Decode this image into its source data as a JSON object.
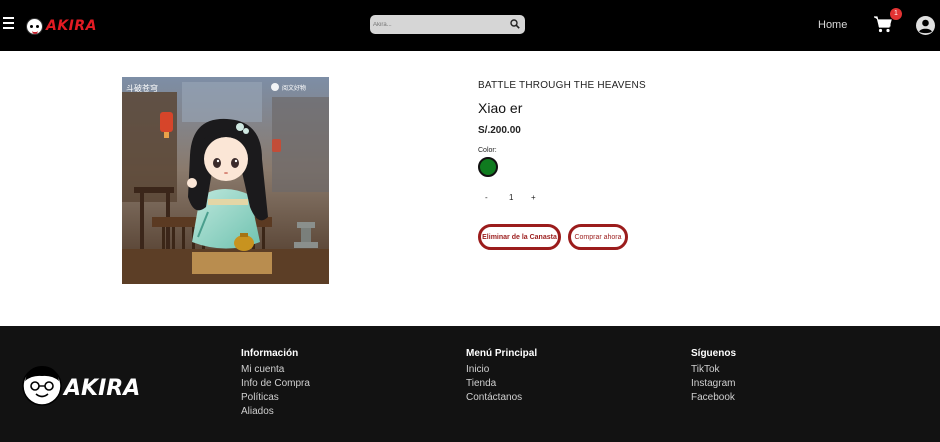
{
  "header": {
    "logo_text": "AKIRA",
    "search_placeholder": "Akira...",
    "nav_home": "Home",
    "cart_count": "1"
  },
  "product": {
    "brand": "BATTLE THROUGH THE HEAVENS",
    "name": "Xiao er",
    "price": "S/.200.00",
    "color_label": "Color:",
    "color_value": "#0f7b1f",
    "qty_minus": "-",
    "qty_value": "1",
    "qty_plus": "+",
    "remove_label": "Eliminar de la Canasta",
    "buy_label": "Comprar ahora"
  },
  "footer": {
    "logo_text": "AKIRA",
    "columns": [
      {
        "title": "Información",
        "links": [
          "Mi cuenta",
          "Info de Compra",
          "Políticas",
          "Aliados"
        ]
      },
      {
        "title": "Menú Principal",
        "links": [
          "Inicio",
          "Tienda",
          "Contáctanos"
        ]
      },
      {
        "title": "Síguenos",
        "links": [
          "TikTok",
          "Instagram",
          "Facebook"
        ]
      }
    ]
  },
  "colors": {
    "header_bg": "#000000",
    "footer_bg": "#121212",
    "accent": "#9b1c1c",
    "logo_red": "#e31b23",
    "badge": "#e23333"
  },
  "icons": [
    "hamburger-icon",
    "search-icon",
    "cart-icon",
    "user-icon"
  ]
}
